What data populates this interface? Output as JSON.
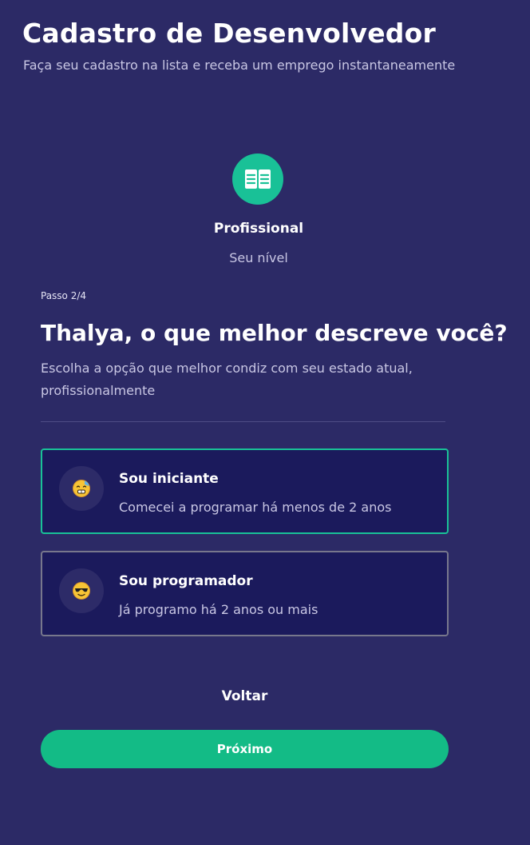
{
  "header": {
    "title": "Cadastro de Desenvolvedor",
    "subtitle": "Faça seu cadastro na lista e receba um emprego instantaneamente"
  },
  "step": {
    "icon": "open-book-icon",
    "name": "Profissional",
    "description": "Seu nível",
    "counter": "Passo 2/4"
  },
  "form": {
    "question": "Thalya, o que melhor descreve você?",
    "help": "Escolha a opção que melhor condiz com seu estado atual, profissionalmente",
    "options": [
      {
        "title": "Sou iniciante",
        "description": "Comecei a programar há menos de 2 anos",
        "icon": "nervous-face-icon",
        "selected": true
      },
      {
        "title": "Sou programador",
        "description": "Já programo há 2 anos ou mais",
        "icon": "sunglasses-face-icon",
        "selected": false
      }
    ]
  },
  "actions": {
    "back_label": "Voltar",
    "next_label": "Próximo"
  },
  "colors": {
    "background": "#2c2a66",
    "accent": "#19c197",
    "button": "#13bb86",
    "card": "#1b1a5c"
  }
}
